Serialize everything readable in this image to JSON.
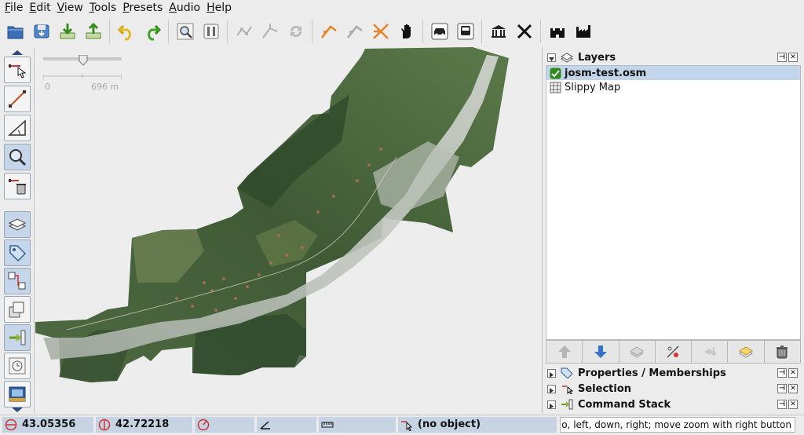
{
  "menu": [
    "File",
    "Edit",
    "View",
    "Tools",
    "Presets",
    "Audio",
    "Help"
  ],
  "map": {
    "scale_start": "0",
    "scale_end": "696 m"
  },
  "layers_panel": {
    "title": "Layers",
    "layers": [
      {
        "name": "josm-test.osm",
        "selected": true,
        "visible": true
      },
      {
        "name": "Slippy Map",
        "selected": false,
        "visible": true
      }
    ]
  },
  "dialogs": {
    "properties": "Properties / Memberships",
    "selection": "Selection",
    "command_stack": "Command Stack"
  },
  "status": {
    "lat": "43.05356",
    "lon": "42.72218",
    "object": "(no object)",
    "help": "o, left, down, right; move zoom with right button"
  },
  "icons": {
    "open": "open-icon",
    "save": "save-icon",
    "download": "download-icon",
    "upload": "upload-icon",
    "undo": "undo-icon",
    "redo": "redo-icon",
    "zoom": "zoom-icon",
    "preferences": "preferences-icon",
    "split_way": "split-way-icon",
    "combine_way": "combine-way-icon",
    "reverse": "reverse-icon",
    "highway_left": "highway-left-icon",
    "highway_right": "highway-right-icon",
    "bicycle": "bicycle-icon",
    "hand": "hand-icon",
    "car": "car-icon",
    "bus": "bus-icon",
    "museum": "museum-icon",
    "crossing": "crossing-icon",
    "castle": "castle-icon",
    "factory": "factory-icon"
  },
  "colors": {
    "selection": "#c3d5ea",
    "status_cell": "#c5d3e3",
    "orange_tool": "#e8832a"
  }
}
